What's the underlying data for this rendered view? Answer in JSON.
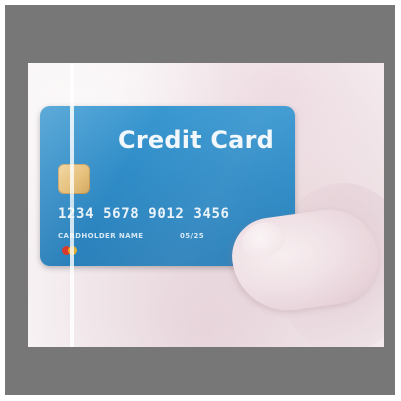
{
  "photo": {
    "card": {
      "title": "Credit Card",
      "number": "1234 5678 9012 3456",
      "holder_label": "CARDHOLDER NAME",
      "expiry": "05/25",
      "colors": {
        "card_blue": "#2f8bc6",
        "chip_gold": "#e6c27e",
        "logo_red": "#d93a2b",
        "logo_yellow": "#f0b323"
      }
    },
    "colors": {
      "outer_border": "#777777",
      "background_white": "#ffffff"
    }
  }
}
